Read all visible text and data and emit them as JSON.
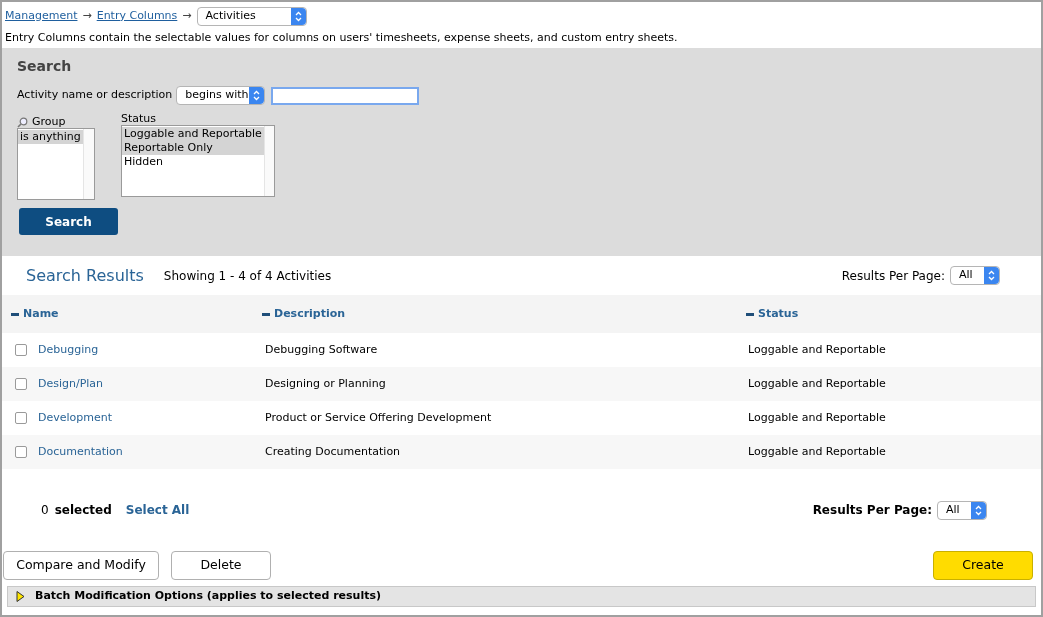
{
  "breadcrumb": {
    "items": [
      {
        "kind": "link",
        "text": "Management"
      },
      {
        "kind": "arrow",
        "text": "→"
      },
      {
        "kind": "link",
        "text": "Entry Columns"
      },
      {
        "kind": "arrow",
        "text": "→"
      }
    ],
    "select": "Activities"
  },
  "description": "Entry Columns contain the selectable values for columns on users' timesheets, expense sheets, and custom entry sheets.",
  "search": {
    "title": "Search",
    "field_label": "Activity name or description",
    "operator": "begins with",
    "group": {
      "label": "Group",
      "options": [
        {
          "label": "is anything",
          "selected": true
        }
      ]
    },
    "status": {
      "label": "Status",
      "options": [
        {
          "label": "Loggable and Reportable",
          "selected": true
        },
        {
          "label": "Reportable Only",
          "selected": true
        },
        {
          "label": "Hidden",
          "selected": false
        }
      ]
    },
    "button": "Search"
  },
  "results": {
    "title": "Search Results",
    "showing": "Showing 1 - 4 of 4 Activities",
    "per_page_label": "Results Per Page:",
    "per_page": "All",
    "columns": [
      {
        "label": "Name"
      },
      {
        "label": "Description"
      },
      {
        "label": "Status"
      }
    ],
    "rows": [
      {
        "name": "Debugging",
        "description": "Debugging Software",
        "status": "Loggable and Reportable",
        "checked": false
      },
      {
        "name": "Design/Plan",
        "description": "Designing or Planning",
        "status": "Loggable and Reportable",
        "checked": false
      },
      {
        "name": "Development",
        "description": "Product or Service Offering Development",
        "status": "Loggable and Reportable",
        "checked": false
      },
      {
        "name": "Documentation",
        "description": "Creating Documentation",
        "status": "Loggable and Reportable",
        "checked": false
      }
    ],
    "selected_count": "0",
    "selected_label": "selected",
    "select_all": "Select All",
    "bottom_per_page_label": "Results Per Page:",
    "bottom_per_page": "All"
  },
  "actions": {
    "left": [
      "Compare and Modify",
      "Delete"
    ],
    "create": "Create"
  },
  "batch": {
    "label": "Batch Modification Options (applies to selected results)",
    "expanded": false
  }
}
